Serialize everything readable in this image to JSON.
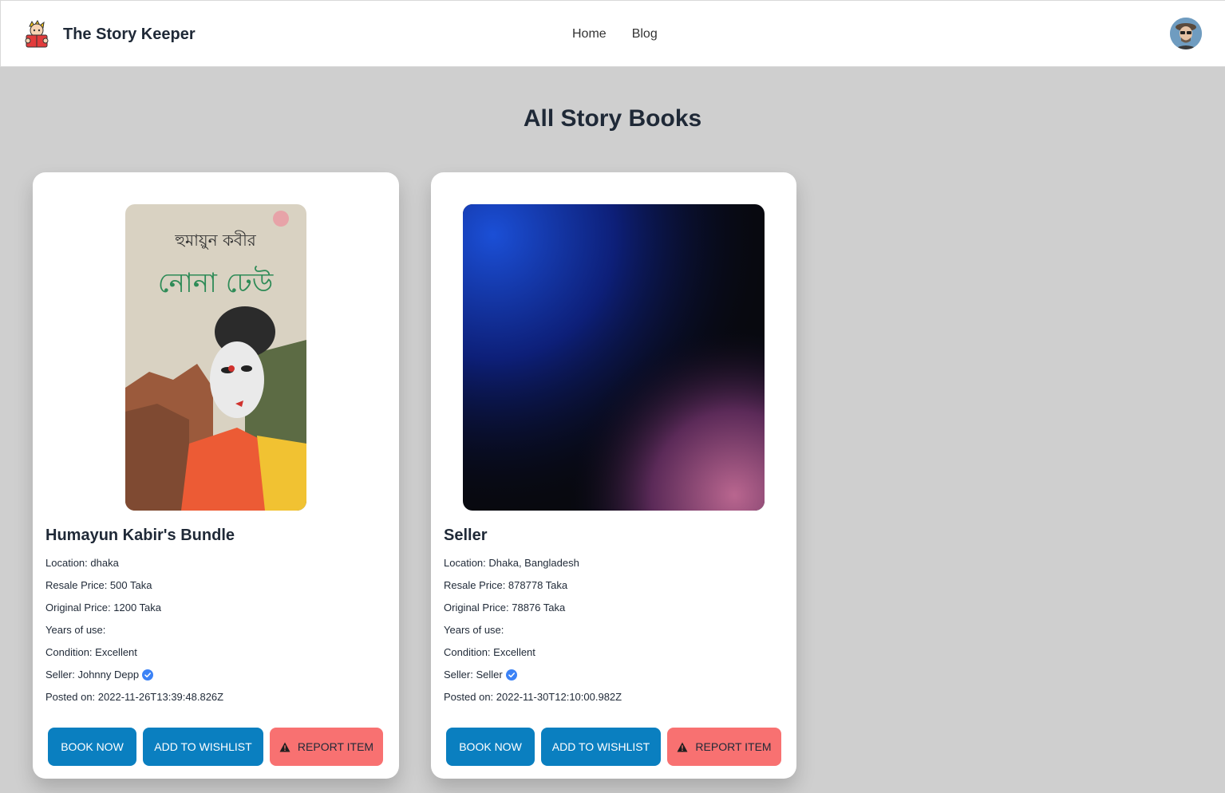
{
  "navbar": {
    "brand_name": "The Story Keeper",
    "links": [
      "Home",
      "Blog"
    ]
  },
  "page_title": "All Story Books",
  "colors": {
    "primary_button": "#0a7fc0",
    "report_button": "#f87171",
    "verified_badge": "#3b82f6",
    "page_background": "#cfcfcf"
  },
  "books": [
    {
      "title": "Humayun Kabir's Bundle",
      "cover_text_top": "হুমায়ুন কবীর",
      "cover_text_title": "নোনা ঢেউ",
      "location": "Location: dhaka",
      "resale_price": "Resale Price: 500 Taka",
      "original_price": "Original Price: 1200 Taka",
      "years_of_use": "Years of use:",
      "condition": "Condition: Excellent",
      "seller": "Seller: Johnny Depp",
      "posted_on": "Posted on: 2022-11-26T13:39:48.826Z",
      "buttons": {
        "book": "BOOK NOW",
        "wishlist": "ADD TO WISHLIST",
        "report": "REPORT ITEM"
      }
    },
    {
      "title": "Seller",
      "location": "Location: Dhaka, Bangladesh",
      "resale_price": "Resale Price: 878778 Taka",
      "original_price": "Original Price: 78876 Taka",
      "years_of_use": "Years of use:",
      "condition": "Condition: Excellent",
      "seller": "Seller: Seller",
      "posted_on": "Posted on: 2022-11-30T12:10:00.982Z",
      "buttons": {
        "book": "BOOK NOW",
        "wishlist": "ADD TO WISHLIST",
        "report": "REPORT ITEM"
      }
    }
  ]
}
